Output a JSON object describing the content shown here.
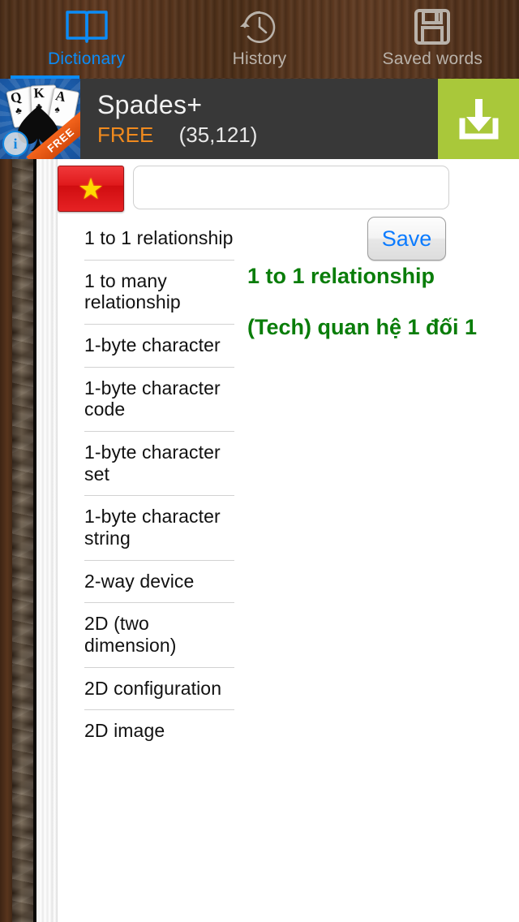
{
  "tabs": [
    {
      "label": "Dictionary",
      "icon": "book-icon",
      "active": true
    },
    {
      "label": "History",
      "icon": "clock-history-icon",
      "active": false
    },
    {
      "label": "Saved words",
      "icon": "floppy-disk-icon",
      "active": false
    }
  ],
  "ad": {
    "title": "Spades+",
    "price": "FREE",
    "rating_count": "(35,121)",
    "cta_icon": "download-icon",
    "info_badge": "i",
    "ribbon": "FREE",
    "cards": [
      {
        "rank": "Q",
        "suit": "♣"
      },
      {
        "rank": "K",
        "suit": "♣"
      },
      {
        "rank": "A",
        "suit": "♠"
      }
    ],
    "background_color": "#383838",
    "cta_color": "#a9c83a",
    "price_color": "#f08a1e"
  },
  "search": {
    "language_flag": "vietnam-flag",
    "value": "",
    "placeholder": "",
    "save_label": "Save",
    "save_color": "#0b7bff"
  },
  "word_list": [
    "1 to 1 relationship",
    "1 to many relationship",
    "1-byte character",
    "1-byte character code",
    "1-byte character set",
    "1-byte character string",
    "2-way device",
    "2D (two dimension)",
    "2D configuration",
    "2D image"
  ],
  "definition": {
    "headword": "1 to 1 relationship",
    "body": "(Tech) quan hệ 1 đối 1",
    "color": "#0a7d0a"
  }
}
